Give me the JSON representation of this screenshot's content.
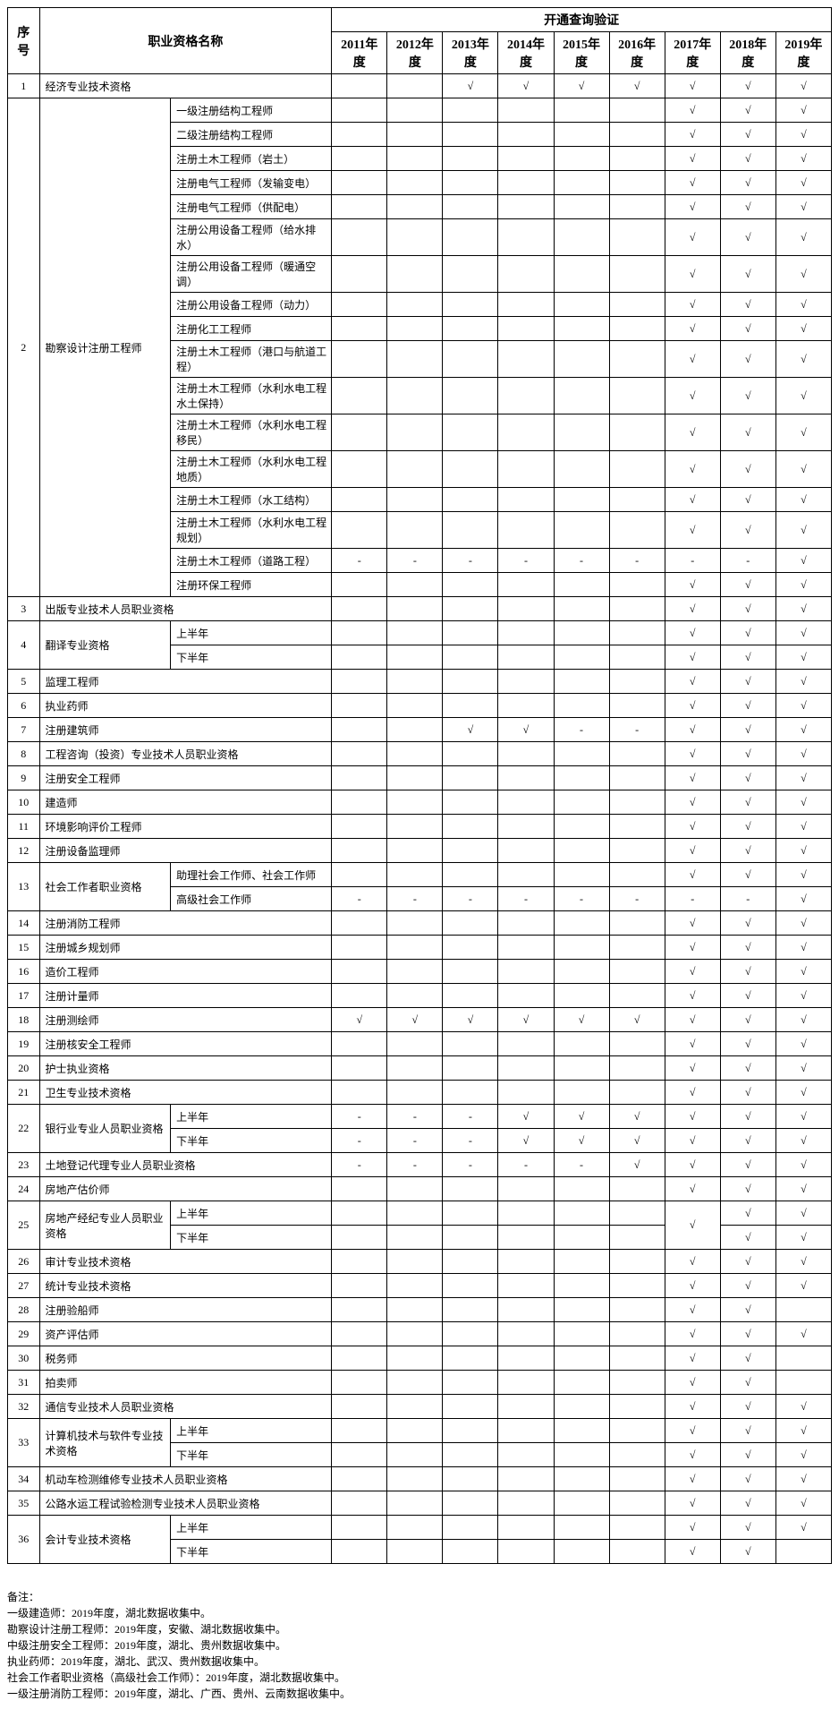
{
  "headers": {
    "col_idx": "序号",
    "col_name": "职业资格名称",
    "col_group": "开通查询验证",
    "years": [
      "2011年度",
      "2012年度",
      "2013年度",
      "2014年度",
      "2015年度",
      "2016年度",
      "2017年度",
      "2018年度",
      "2019年度"
    ]
  },
  "chart_data": {
    "type": "table",
    "rows": [
      {
        "idx": "1",
        "main": "经济专业技术资格",
        "sub": null,
        "vals": [
          "",
          "",
          "√",
          "√",
          "√",
          "√",
          "√",
          "√",
          "√"
        ]
      },
      {
        "idx": "2",
        "main": "勘察设计注册工程师",
        "sub": "一级注册结构工程师",
        "vals": [
          "",
          "",
          "",
          "",
          "",
          "",
          "√",
          "√",
          "√"
        ],
        "mainspan": 16
      },
      {
        "idx": null,
        "main": null,
        "sub": "二级注册结构工程师",
        "vals": [
          "",
          "",
          "",
          "",
          "",
          "",
          "√",
          "√",
          "√"
        ]
      },
      {
        "idx": null,
        "main": null,
        "sub": "注册土木工程师（岩土）",
        "vals": [
          "",
          "",
          "",
          "",
          "",
          "",
          "√",
          "√",
          "√"
        ]
      },
      {
        "idx": null,
        "main": null,
        "sub": "注册电气工程师（发输变电）",
        "vals": [
          "",
          "",
          "",
          "",
          "",
          "",
          "√",
          "√",
          "√"
        ]
      },
      {
        "idx": null,
        "main": null,
        "sub": "注册电气工程师（供配电）",
        "vals": [
          "",
          "",
          "",
          "",
          "",
          "",
          "√",
          "√",
          "√"
        ]
      },
      {
        "idx": null,
        "main": null,
        "sub": "注册公用设备工程师（给水排水）",
        "vals": [
          "",
          "",
          "",
          "",
          "",
          "",
          "√",
          "√",
          "√"
        ]
      },
      {
        "idx": null,
        "main": null,
        "sub": "注册公用设备工程师（暖通空调）",
        "vals": [
          "",
          "",
          "",
          "",
          "",
          "",
          "√",
          "√",
          "√"
        ]
      },
      {
        "idx": null,
        "main": null,
        "sub": "注册公用设备工程师（动力）",
        "vals": [
          "",
          "",
          "",
          "",
          "",
          "",
          "√",
          "√",
          "√"
        ]
      },
      {
        "idx": null,
        "main": null,
        "sub": "注册化工工程师",
        "vals": [
          "",
          "",
          "",
          "",
          "",
          "",
          "√",
          "√",
          "√"
        ]
      },
      {
        "idx": null,
        "main": null,
        "sub": "注册土木工程师（港口与航道工程）",
        "vals": [
          "",
          "",
          "",
          "",
          "",
          "",
          "√",
          "√",
          "√"
        ]
      },
      {
        "idx": null,
        "main": null,
        "sub": "注册土木工程师（水利水电工程水土保持）",
        "vals": [
          "",
          "",
          "",
          "",
          "",
          "",
          "√",
          "√",
          "√"
        ]
      },
      {
        "idx": null,
        "main": null,
        "sub": "注册土木工程师（水利水电工程移民）",
        "vals": [
          "",
          "",
          "",
          "",
          "",
          "",
          "√",
          "√",
          "√"
        ]
      },
      {
        "idx": null,
        "main": null,
        "sub": "注册土木工程师（水利水电工程地质）",
        "vals": [
          "",
          "",
          "",
          "",
          "",
          "",
          "√",
          "√",
          "√"
        ]
      },
      {
        "idx": null,
        "main": null,
        "sub": "注册土木工程师（水工结构）",
        "vals": [
          "",
          "",
          "",
          "",
          "",
          "",
          "√",
          "√",
          "√"
        ]
      },
      {
        "idx": null,
        "main": null,
        "sub": "注册土木工程师（水利水电工程规划）",
        "vals": [
          "",
          "",
          "",
          "",
          "",
          "",
          "√",
          "√",
          "√"
        ]
      },
      {
        "idx": null,
        "main": null,
        "sub": "注册土木工程师（道路工程）",
        "vals": [
          "-",
          "-",
          "-",
          "-",
          "-",
          "-",
          "-",
          "-",
          "√"
        ]
      },
      {
        "idx": null,
        "main": null,
        "sub": "注册环保工程师",
        "vals": [
          "",
          "",
          "",
          "",
          "",
          "",
          "√",
          "√",
          "√"
        ]
      },
      {
        "idx": "3",
        "main": "出版专业技术人员职业资格",
        "sub": null,
        "vals": [
          "",
          "",
          "",
          "",
          "",
          "",
          "√",
          "√",
          "√"
        ]
      },
      {
        "idx": "4",
        "main": "翻译专业资格",
        "sub": "上半年",
        "vals": [
          "",
          "",
          "",
          "",
          "",
          "",
          "√",
          "√",
          "√"
        ],
        "mainspan": 2
      },
      {
        "idx": null,
        "main": null,
        "sub": "下半年",
        "vals": [
          "",
          "",
          "",
          "",
          "",
          "",
          "√",
          "√",
          "√"
        ]
      },
      {
        "idx": "5",
        "main": "监理工程师",
        "sub": null,
        "vals": [
          "",
          "",
          "",
          "",
          "",
          "",
          "√",
          "√",
          "√"
        ]
      },
      {
        "idx": "6",
        "main": "执业药师",
        "sub": null,
        "vals": [
          "",
          "",
          "",
          "",
          "",
          "",
          "√",
          "√",
          "√"
        ]
      },
      {
        "idx": "7",
        "main": "注册建筑师",
        "sub": null,
        "vals": [
          "",
          "",
          "",
          "√",
          "√",
          "-",
          "-",
          "√",
          "√",
          "√"
        ]
      },
      {
        "idx": "8",
        "main": "工程咨询（投资）专业技术人员职业资格",
        "sub": null,
        "vals": [
          "",
          "",
          "",
          "",
          "",
          "",
          "√",
          "√",
          "√"
        ]
      },
      {
        "idx": "9",
        "main": "注册安全工程师",
        "sub": null,
        "vals": [
          "",
          "",
          "",
          "",
          "",
          "",
          "√",
          "√",
          "√"
        ]
      },
      {
        "idx": "10",
        "main": "建造师",
        "sub": null,
        "vals": [
          "",
          "",
          "",
          "",
          "",
          "",
          "√",
          "√",
          "√"
        ]
      },
      {
        "idx": "11",
        "main": "环境影响评价工程师",
        "sub": null,
        "vals": [
          "",
          "",
          "",
          "",
          "",
          "",
          "√",
          "√",
          "√"
        ]
      },
      {
        "idx": "12",
        "main": "注册设备监理师",
        "sub": null,
        "vals": [
          "",
          "",
          "",
          "",
          "",
          "",
          "√",
          "√",
          "√"
        ]
      },
      {
        "idx": "13",
        "main": "社会工作者职业资格",
        "sub": "助理社会工作师、社会工作师",
        "vals": [
          "",
          "",
          "",
          "",
          "",
          "",
          "√",
          "√",
          "√"
        ],
        "mainspan": 2
      },
      {
        "idx": null,
        "main": null,
        "sub": "高级社会工作师",
        "vals": [
          "-",
          "-",
          "-",
          "-",
          "-",
          "-",
          "-",
          "-",
          "√"
        ]
      },
      {
        "idx": "14",
        "main": "注册消防工程师",
        "sub": null,
        "vals": [
          "",
          "",
          "",
          "",
          "",
          "",
          "√",
          "√",
          "√"
        ]
      },
      {
        "idx": "15",
        "main": "注册城乡规划师",
        "sub": null,
        "vals": [
          "",
          "",
          "",
          "",
          "",
          "",
          "√",
          "√",
          "√"
        ]
      },
      {
        "idx": "16",
        "main": "造价工程师",
        "sub": null,
        "vals": [
          "",
          "",
          "",
          "",
          "",
          "",
          "√",
          "√",
          "√"
        ]
      },
      {
        "idx": "17",
        "main": "注册计量师",
        "sub": null,
        "vals": [
          "",
          "",
          "",
          "",
          "",
          "",
          "√",
          "√",
          "√"
        ]
      },
      {
        "idx": "18",
        "main": "注册测绘师",
        "sub": null,
        "vals": [
          "√",
          "√",
          "√",
          "√",
          "√",
          "√",
          "√",
          "√",
          "√"
        ]
      },
      {
        "idx": "19",
        "main": "注册核安全工程师",
        "sub": null,
        "vals": [
          "",
          "",
          "",
          "",
          "",
          "",
          "√",
          "√",
          "√"
        ]
      },
      {
        "idx": "20",
        "main": "护士执业资格",
        "sub": null,
        "vals": [
          "",
          "",
          "",
          "",
          "",
          "",
          "√",
          "√",
          "√"
        ]
      },
      {
        "idx": "21",
        "main": "卫生专业技术资格",
        "sub": null,
        "vals": [
          "",
          "",
          "",
          "",
          "",
          "",
          "√",
          "√",
          "√"
        ]
      },
      {
        "idx": "22",
        "main": "银行业专业人员职业资格",
        "sub": "上半年",
        "vals": [
          "-",
          "-",
          "-",
          "√",
          "√",
          "√",
          "√",
          "√",
          "√"
        ],
        "mainspan": 2
      },
      {
        "idx": null,
        "main": null,
        "sub": "下半年",
        "vals": [
          "-",
          "-",
          "-",
          "√",
          "√",
          "√",
          "√",
          "√",
          "√"
        ]
      },
      {
        "idx": "23",
        "main": "土地登记代理专业人员职业资格",
        "sub": null,
        "vals": [
          "-",
          "-",
          "-",
          "-",
          "-",
          "√",
          "√",
          "√",
          "√"
        ]
      },
      {
        "idx": "24",
        "main": "房地产估价师",
        "sub": null,
        "vals": [
          "",
          "",
          "",
          "",
          "",
          "",
          "√",
          "√",
          "√"
        ]
      },
      {
        "idx": "25",
        "main": "房地产经纪专业人员职业资格",
        "sub": "上半年",
        "vals": [
          "",
          "",
          "",
          "",
          "",
          "",
          "",
          "√",
          "√"
        ],
        "mainspan": 2,
        "merge2017": true,
        "val2017": "√"
      },
      {
        "idx": null,
        "main": null,
        "sub": "下半年",
        "vals": [
          "",
          "",
          "",
          "",
          "",
          "",
          "",
          "√",
          "√"
        ]
      },
      {
        "idx": "26",
        "main": "审计专业技术资格",
        "sub": null,
        "vals": [
          "",
          "",
          "",
          "",
          "",
          "",
          "√",
          "√",
          "√"
        ]
      },
      {
        "idx": "27",
        "main": "统计专业技术资格",
        "sub": null,
        "vals": [
          "",
          "",
          "",
          "",
          "",
          "",
          "√",
          "√",
          "√"
        ]
      },
      {
        "idx": "28",
        "main": "注册验船师",
        "sub": null,
        "vals": [
          "",
          "",
          "",
          "",
          "",
          "",
          "√",
          "√",
          ""
        ]
      },
      {
        "idx": "29",
        "main": "资产评估师",
        "sub": null,
        "vals": [
          "",
          "",
          "",
          "",
          "",
          "",
          "√",
          "√",
          "√"
        ]
      },
      {
        "idx": "30",
        "main": "税务师",
        "sub": null,
        "vals": [
          "",
          "",
          "",
          "",
          "",
          "",
          "√",
          "√",
          ""
        ]
      },
      {
        "idx": "31",
        "main": "拍卖师",
        "sub": null,
        "vals": [
          "",
          "",
          "",
          "",
          "",
          "",
          "√",
          "√",
          ""
        ]
      },
      {
        "idx": "32",
        "main": "通信专业技术人员职业资格",
        "sub": null,
        "vals": [
          "",
          "",
          "",
          "",
          "",
          "",
          "√",
          "√",
          "√"
        ]
      },
      {
        "idx": "33",
        "main": "计算机技术与软件专业技术资格",
        "sub": "上半年",
        "vals": [
          "",
          "",
          "",
          "",
          "",
          "",
          "√",
          "√",
          "√"
        ],
        "mainspan": 2
      },
      {
        "idx": null,
        "main": null,
        "sub": "下半年",
        "vals": [
          "",
          "",
          "",
          "",
          "",
          "",
          "√",
          "√",
          "√"
        ]
      },
      {
        "idx": "34",
        "main": "机动车检测维修专业技术人员职业资格",
        "sub": null,
        "vals": [
          "",
          "",
          "",
          "",
          "",
          "",
          "√",
          "√",
          "√"
        ]
      },
      {
        "idx": "35",
        "main": "公路水运工程试验检测专业技术人员职业资格",
        "sub": null,
        "vals": [
          "",
          "",
          "",
          "",
          "",
          "",
          "√",
          "√",
          "√"
        ]
      },
      {
        "idx": "36",
        "main": "会计专业技术资格",
        "sub": "上半年",
        "vals": [
          "",
          "",
          "",
          "",
          "",
          "",
          "√",
          "√",
          "√"
        ],
        "mainspan": 2
      },
      {
        "idx": null,
        "main": null,
        "sub": "下半年",
        "vals": [
          "",
          "",
          "",
          "",
          "",
          "",
          "√",
          "√",
          ""
        ]
      }
    ]
  },
  "notes_title": "备注：",
  "notes": [
    "一级建造师：2019年度，湖北数据收集中。",
    "勘察设计注册工程师：2019年度，安徽、湖北数据收集中。",
    "中级注册安全工程师：2019年度，湖北、贵州数据收集中。",
    "执业药师：2019年度，湖北、武汉、贵州数据收集中。",
    "社会工作者职业资格（高级社会工作师）：2019年度，湖北数据收集中。",
    "一级注册消防工程师：2019年度，湖北、广西、贵州、云南数据收集中。"
  ]
}
